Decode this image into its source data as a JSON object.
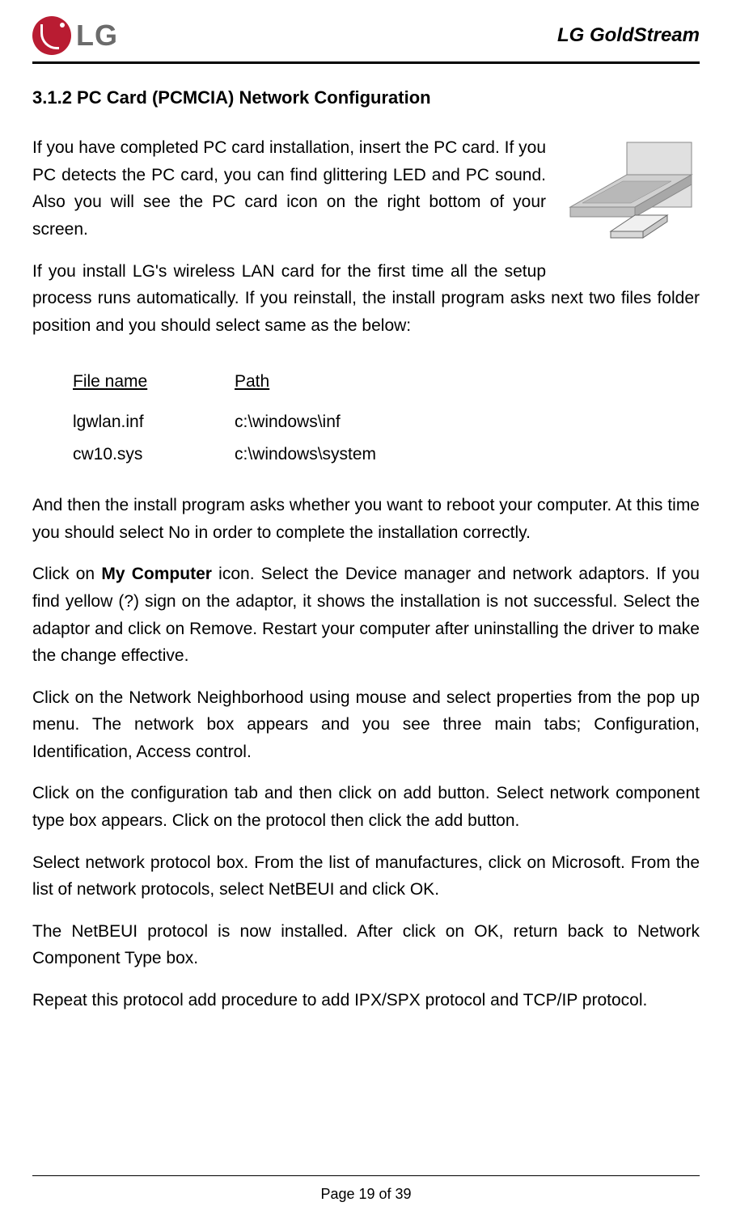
{
  "header": {
    "logo_text": "LG",
    "brand_title": "LG GoldStream"
  },
  "content": {
    "section_heading": "3.1.2 PC Card (PCMCIA) Network Configuration",
    "para1": "If you have completed PC card installation, insert the PC card. If you PC detects the PC card, you can find glittering LED and PC sound. Also you will see the PC card icon on the right bottom of your screen.",
    "para2": "If you install LG's wireless LAN card for the first time all the setup process runs automatically. If you reinstall, the install program asks next two files folder position and you should select same as the below:",
    "table": {
      "header_file": "File name",
      "header_path": "Path",
      "rows": [
        {
          "file": "lgwlan.inf",
          "path": "c:\\windows\\inf"
        },
        {
          "file": "cw10.sys",
          "path": "c:\\windows\\system"
        }
      ]
    },
    "para3": "And then the install program asks whether you want to reboot your computer. At this time you should select No in order to complete the installation correctly.",
    "para4_pre": "Click on ",
    "para4_bold": "My Computer",
    "para4_post": " icon. Select the Device manager and network adaptors. If you find yellow (?) sign on the adaptor, it shows the installation is not successful. Select the adaptor and click on Remove. Restart your computer after uninstalling the driver to make the change effective.",
    "para5": "Click on the Network Neighborhood using mouse and select properties from the pop up menu. The network box appears and you see three main tabs; Configuration, Identification, Access control.",
    "para6": "Click on the configuration tab and then click on add button. Select network component type box appears. Click on the protocol then click the add button.",
    "para7": "Select network protocol box. From the list of manufactures, click on Microsoft. From the list of network protocols, select NetBEUI and click OK.",
    "para8": "The NetBEUI protocol is now installed. After click on OK, return back to Network Component Type box.",
    "para9": "Repeat this protocol add procedure to add IPX/SPX protocol and TCP/IP protocol."
  },
  "footer": {
    "page_label": "Page 19 of 39"
  }
}
